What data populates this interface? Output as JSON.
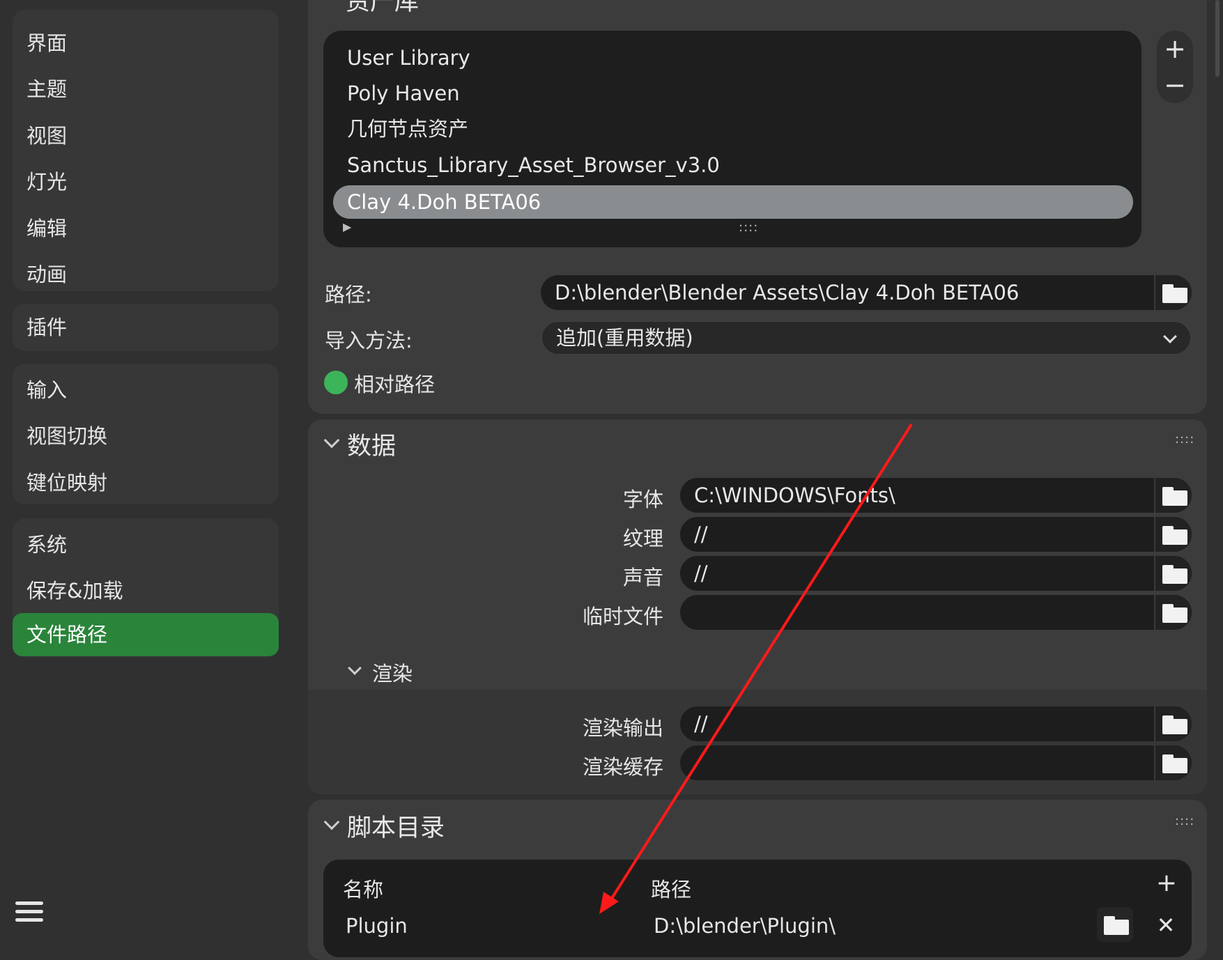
{
  "sidebar": {
    "group1": [
      "界面",
      "主题",
      "视图",
      "灯光",
      "编辑",
      "动画"
    ],
    "group2": [
      "插件"
    ],
    "group3": [
      "输入",
      "视图切换",
      "键位映射"
    ],
    "group4": [
      "系统",
      "保存&加载",
      "文件路径"
    ],
    "active_item": "文件路径",
    "menu_icon": "hamburger-menu-icon"
  },
  "asset_libraries": {
    "section_title": "资产库",
    "items": [
      "User Library",
      "Poly Haven",
      "几何节点资产",
      "Sanctus_Library_Asset_Browser_v3.0",
      "Clay 4.Doh BETA06"
    ],
    "selected": "Clay 4.Doh BETA06",
    "add_symbol": "+",
    "remove_symbol": "−",
    "expand_symbol": "▶",
    "resize_grip": "::::",
    "path_label": "路径:",
    "path_value": "D:\\blender\\Blender Assets\\Clay 4.Doh BETA06",
    "import_label": "导入方法:",
    "import_value": "追加(重用数据)",
    "relative_label": "相对路径"
  },
  "data_section": {
    "title": "数据",
    "grip": "::::",
    "rows": [
      {
        "label": "字体",
        "value": "C:\\WINDOWS\\Fonts\\"
      },
      {
        "label": "纹理",
        "value": "//"
      },
      {
        "label": "声音",
        "value": "//"
      },
      {
        "label": "临时文件",
        "value": ""
      }
    ],
    "render": {
      "title": "渲染",
      "rows": [
        {
          "label": "渲染输出",
          "value": "//"
        },
        {
          "label": "渲染缓存",
          "value": ""
        }
      ]
    }
  },
  "script_section": {
    "title": "脚本目录",
    "grip": "::::",
    "col_name": "名称",
    "col_path": "路径",
    "add_symbol": "+",
    "row": {
      "name": "Plugin",
      "path": "D:\\blender\\Plugin\\",
      "remove_symbol": "✕"
    }
  },
  "colors": {
    "accent_green": "#2a843a",
    "toggle_green": "#3cb55a",
    "annotation_arrow": "#ff1a1a",
    "selection_gray": "#8a8d8f"
  }
}
